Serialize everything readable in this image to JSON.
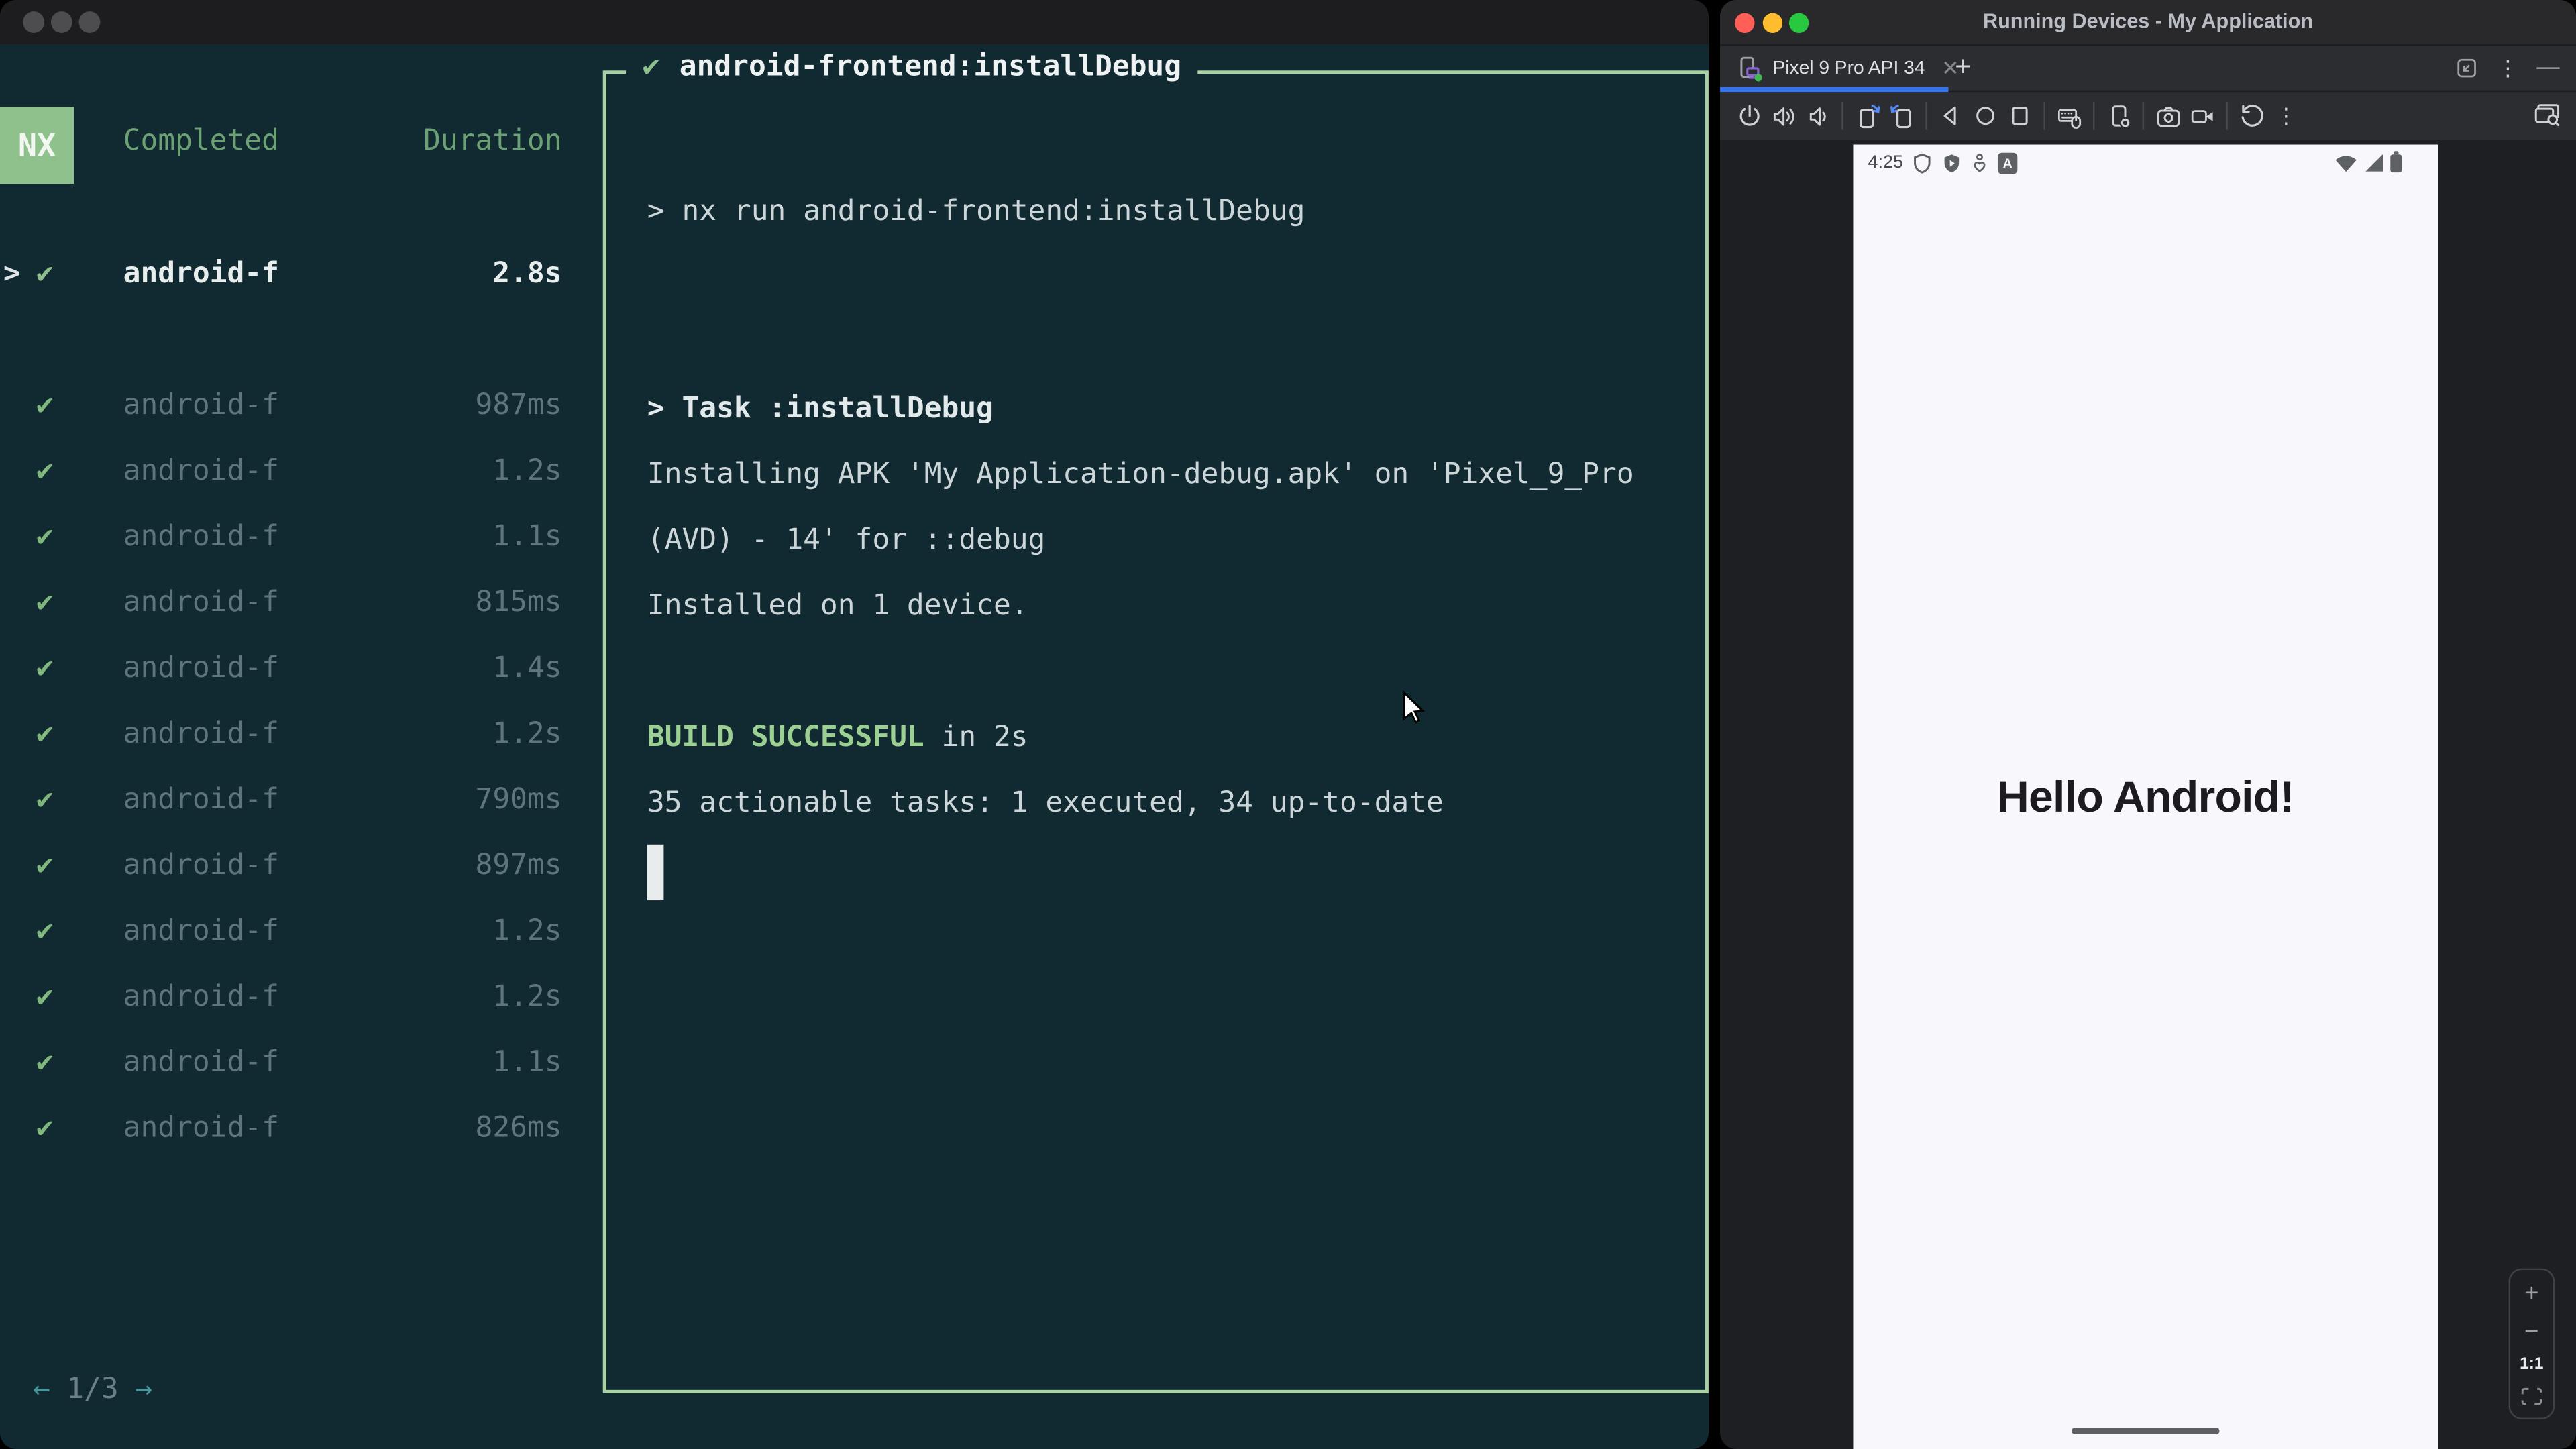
{
  "left_window": {
    "logo": "NX",
    "columns": {
      "completed": "Completed",
      "duration": "Duration"
    },
    "check_glyph": "✔",
    "selected_caret": ">",
    "tasks": [
      {
        "name": "android-f",
        "duration": "2.8s",
        "selected": true
      },
      {
        "name": "android-f",
        "duration": "987ms"
      },
      {
        "name": "android-f",
        "duration": "1.2s"
      },
      {
        "name": "android-f",
        "duration": "1.1s"
      },
      {
        "name": "android-f",
        "duration": "815ms"
      },
      {
        "name": "android-f",
        "duration": "1.4s"
      },
      {
        "name": "android-f",
        "duration": "1.2s"
      },
      {
        "name": "android-f",
        "duration": "790ms"
      },
      {
        "name": "android-f",
        "duration": "897ms"
      },
      {
        "name": "android-f",
        "duration": "1.2s"
      },
      {
        "name": "android-f",
        "duration": "1.2s"
      },
      {
        "name": "android-f",
        "duration": "1.1s"
      },
      {
        "name": "android-f",
        "duration": "826ms"
      }
    ],
    "pagination": {
      "prev": "←",
      "page": "1/3",
      "next": "→"
    },
    "panel": {
      "title": "android-frontend:installDebug",
      "cmd": "> nx run android-frontend:installDebug",
      "task_line": "> Task :installDebug",
      "install_line1": "Installing APK 'My Application-debug.apk' on 'Pixel_9_Pro",
      "install_line2": "(AVD) - 14' for ::debug",
      "installed_line": "Installed on 1 device.",
      "build_status": "BUILD SUCCESSFUL",
      "build_suffix": " in 2s",
      "summary_line": "35 actionable tasks: 1 executed, 34 up-to-date"
    }
  },
  "right_window": {
    "title": "Running Devices - My Application",
    "tab": {
      "label": "Pixel 9 Pro API 34",
      "close": "✕",
      "add": "+"
    },
    "window_icons": {
      "more": "⋮"
    },
    "toolbar_icons": [
      "power",
      "volume-up",
      "volume-down",
      "rotate-left",
      "rotate-right",
      "back",
      "home",
      "overview",
      "hardware-input",
      "device-settings",
      "screenshot",
      "screen-record",
      "restart",
      "more-actions",
      "display-mode"
    ],
    "emulator": {
      "time": "4:25",
      "app_badge": "A",
      "hello": "Hello Android!",
      "zoom_controls": {
        "zoom_in": "+",
        "zoom_out": "−",
        "actual_size": "1:1"
      }
    }
  },
  "colors": {
    "terminal_bg": "#112a31",
    "accent_green": "#a8d2a2",
    "success_green": "#9ccf92",
    "tab_accent_blue": "#3574f0",
    "screen_bg": "#f8f7fc",
    "traffic_red": "#ff5f57",
    "traffic_yellow": "#febc2e",
    "traffic_green": "#28c840"
  }
}
